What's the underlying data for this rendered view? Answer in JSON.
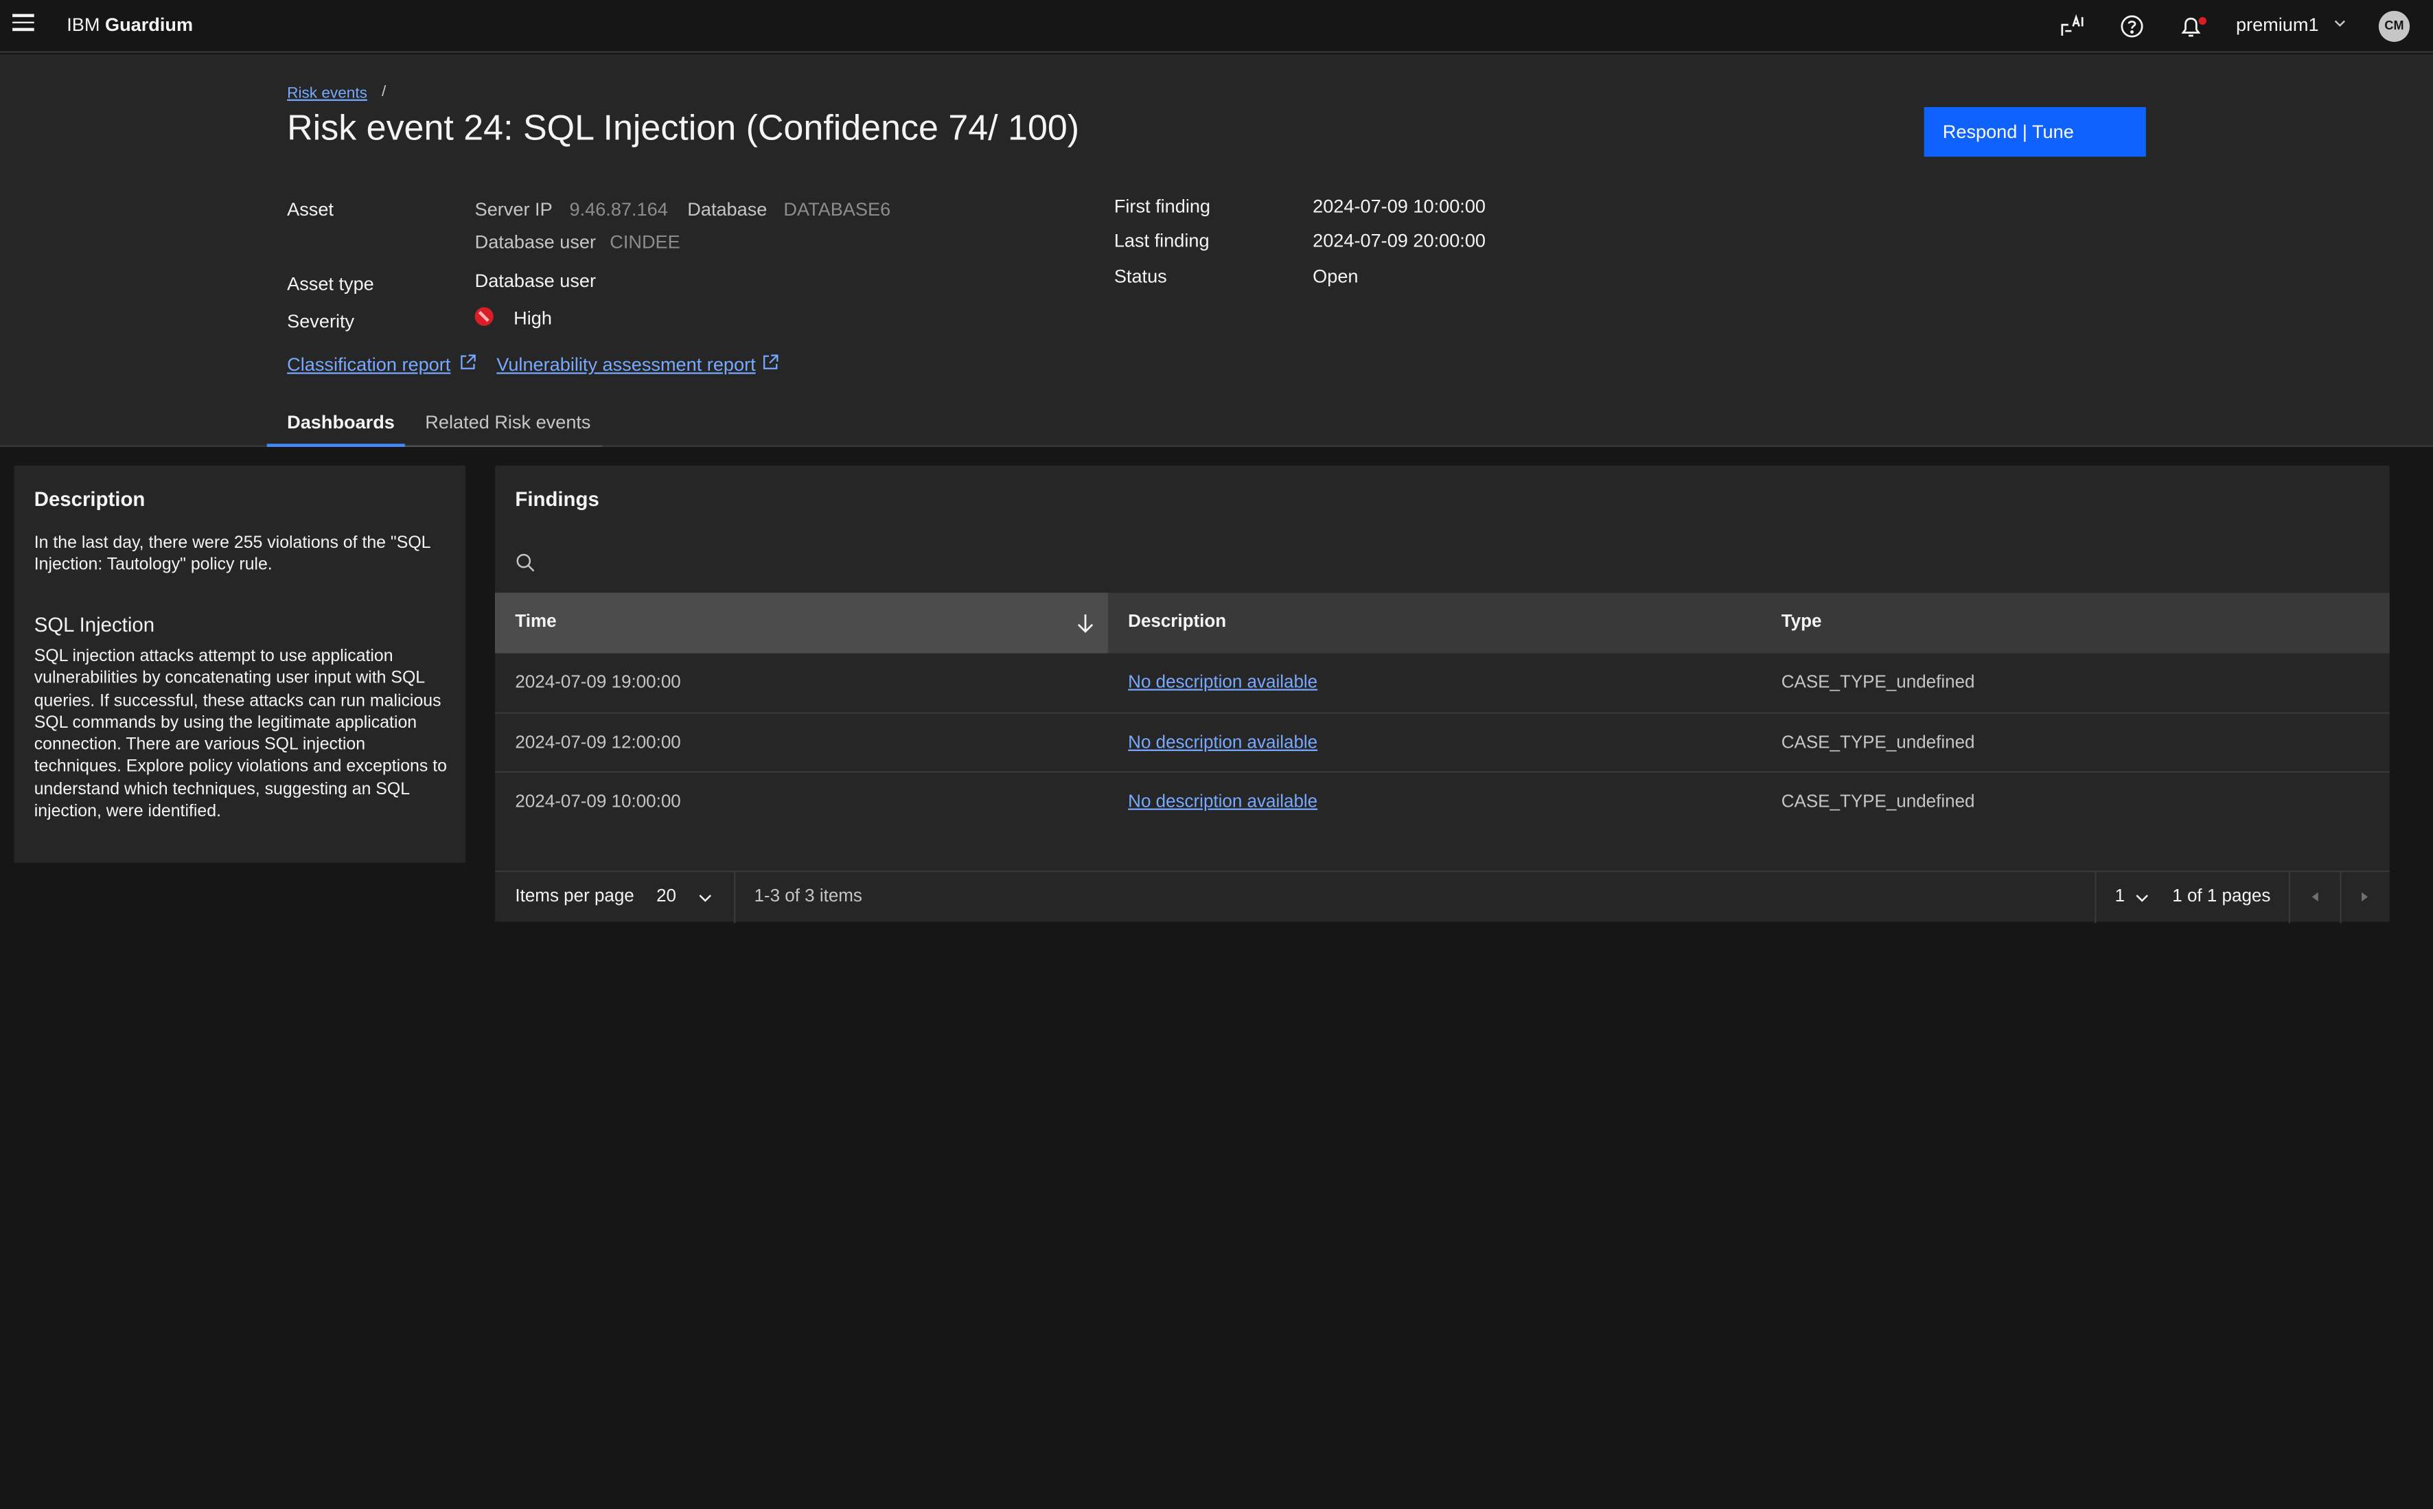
{
  "topbar": {
    "brand_prefix": "IBM",
    "brand_name": "Guardium",
    "user": "premium1",
    "avatar_initials": "CM"
  },
  "breadcrumb": {
    "link": "Risk events",
    "separator": "/"
  },
  "page_title": "Risk event 24: SQL Injection (Confidence 74/ 100)",
  "respond_button": "Respond | Tune",
  "details": {
    "asset_label": "Asset",
    "server_ip_key": "Server IP",
    "server_ip_value": "9.46.87.164",
    "database_key": "Database",
    "database_value": "DATABASE6",
    "db_user_key": "Database user",
    "db_user_value": "CINDEE",
    "asset_type_label": "Asset type",
    "asset_type_value": "Database user",
    "severity_label": "Severity",
    "severity_value": "High",
    "first_finding_label": "First finding",
    "first_finding_value": "2024-07-09 10:00:00",
    "last_finding_label": "Last finding",
    "last_finding_value": "2024-07-09 20:00:00",
    "status_label": "Status",
    "status_value": "Open",
    "classification_link": "Classification report",
    "vulnerability_link": "Vulnerability assessment report"
  },
  "tabs": [
    {
      "label": "Dashboards",
      "active": true
    },
    {
      "label": "Related Risk events",
      "active": false
    }
  ],
  "description_panel": {
    "title": "Description",
    "text": "In the last day, there were 255 violations of the \"SQL Injection: Tautology\" policy rule.",
    "sql_title": "SQL Injection",
    "sql_text": "SQL injection attacks attempt to use application vulnerabilities by concatenating user input with SQL queries. If successful, these attacks can run malicious SQL commands by using the legitimate application connection. There are various SQL injection techniques. Explore policy violations and exceptions to understand which techniques, suggesting an SQL injection, were identified."
  },
  "findings": {
    "title": "Findings",
    "columns": [
      "Time",
      "Description",
      "Type"
    ],
    "rows": [
      {
        "time": "2024-07-09 19:00:00",
        "description": "No description available",
        "type": "CASE_TYPE_undefined"
      },
      {
        "time": "2024-07-09 12:00:00",
        "description": "No description available",
        "type": "CASE_TYPE_undefined"
      },
      {
        "time": "2024-07-09 10:00:00",
        "description": "No description available",
        "type": "CASE_TYPE_undefined"
      }
    ],
    "pagination": {
      "items_per_page_label": "Items per page",
      "items_per_page_value": "20",
      "range_text": "1-3 of 3 items",
      "page_value": "1",
      "pages_text": "1 of 1 pages"
    }
  },
  "colors": {
    "accent": "#0f62fe",
    "link": "#78a9ff",
    "severity_high": "#da1e28",
    "background": "#161616",
    "panel": "#262626"
  },
  "icons": [
    "menu-icon",
    "ai-icon",
    "help-icon",
    "notification-icon",
    "chevron-down-icon",
    "external-link-icon",
    "search-icon",
    "sort-descending-icon",
    "caret-left-icon",
    "caret-right-icon",
    "severity-high-icon"
  ]
}
